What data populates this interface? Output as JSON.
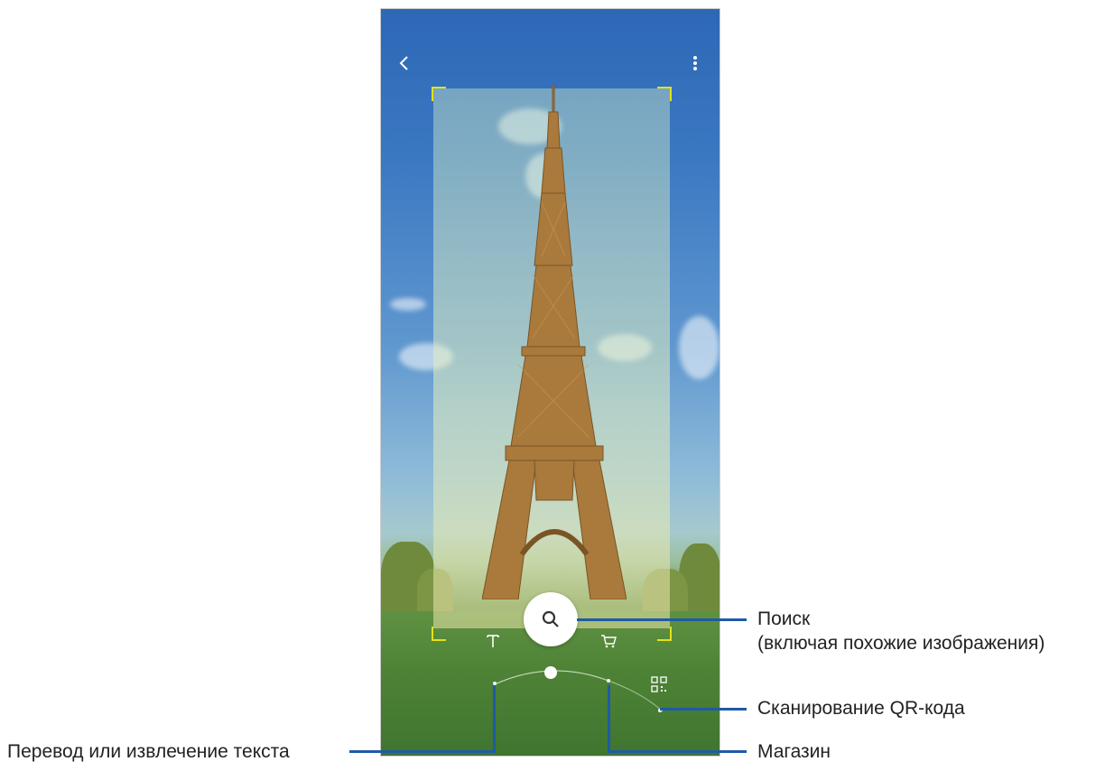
{
  "screen": {
    "top_bar": {
      "back_icon": "chevron-left-icon",
      "menu_icon": "more-vertical-icon"
    },
    "bottom_modes": [
      {
        "name": "text",
        "icon": "text-T-icon"
      },
      {
        "name": "search",
        "icon": "search-icon",
        "active": true
      },
      {
        "name": "shopping",
        "icon": "cart-icon"
      },
      {
        "name": "qr",
        "icon": "qr-code-icon"
      }
    ]
  },
  "callouts": {
    "search": {
      "line1": "Поиск",
      "line2": "(включая похожие изображения)"
    },
    "qr": "Сканирование QR-кода",
    "text": "Перевод или извлечение текста",
    "shop": "Магазин"
  },
  "colors": {
    "callout_line": "#1f5aa6",
    "selection_corner": "#e2e219"
  }
}
